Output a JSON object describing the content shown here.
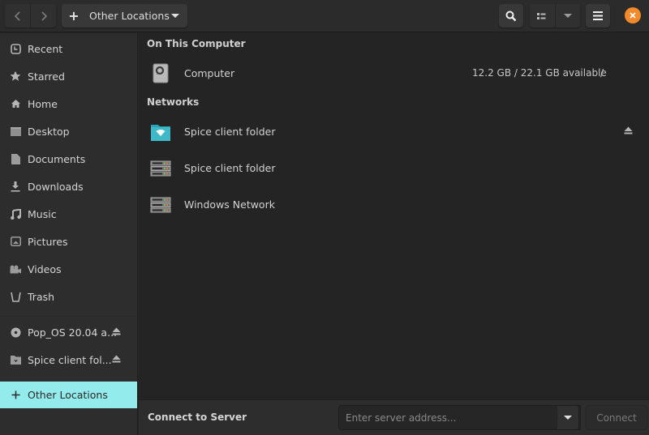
{
  "header": {
    "back_icon": "chevron-left-icon",
    "forward_icon": "chevron-right-icon",
    "location_button": {
      "icon": "plus-icon",
      "label": "Other Locations",
      "caret": "pan-down-icon"
    },
    "search_icon": "search-icon",
    "view_icon": "list-view-icon",
    "view_caret": "pan-down-icon",
    "menu_icon": "hamburger-menu-icon",
    "close_icon": "close-icon",
    "close_color": "#f2892a"
  },
  "sidebar": {
    "items": [
      {
        "label": "Recent",
        "icon": "clock-icon"
      },
      {
        "label": "Starred",
        "icon": "star-icon"
      },
      {
        "label": "Home",
        "icon": "home-icon"
      },
      {
        "label": "Desktop",
        "icon": "desktop-icon"
      },
      {
        "label": "Documents",
        "icon": "document-icon"
      },
      {
        "label": "Downloads",
        "icon": "download-icon"
      },
      {
        "label": "Music",
        "icon": "music-icon"
      },
      {
        "label": "Pictures",
        "icon": "picture-icon"
      },
      {
        "label": "Videos",
        "icon": "video-icon"
      },
      {
        "label": "Trash",
        "icon": "trash-icon"
      }
    ],
    "mounts": [
      {
        "label": "Pop_OS 20.04 a...",
        "icon": "disc-icon",
        "eject": true
      },
      {
        "label": "Spice client fol...",
        "icon": "network-folder-icon",
        "eject": true
      }
    ],
    "active": {
      "label": "Other Locations",
      "icon": "plus-icon"
    },
    "active_color": "#94ebeb"
  },
  "main": {
    "sections": [
      {
        "title": "On This Computer",
        "rows": [
          {
            "label": "Computer",
            "icon": "drive-icon",
            "info": "12.2 GB / 22.1 GB available",
            "path": "/"
          }
        ]
      },
      {
        "title": "Networks",
        "rows": [
          {
            "label": "Spice client folder",
            "icon": "network-folder-icon",
            "eject": true
          },
          {
            "label": "Spice client folder",
            "icon": "server-icon"
          },
          {
            "label": "Windows Network",
            "icon": "server-icon"
          }
        ]
      }
    ]
  },
  "actionbar": {
    "label": "Connect to Server",
    "input_placeholder": "Enter server address...",
    "input_value": "",
    "help_icon": "help-diamond-icon",
    "dropdown_icon": "pan-down-icon",
    "connect_label": "Connect"
  }
}
